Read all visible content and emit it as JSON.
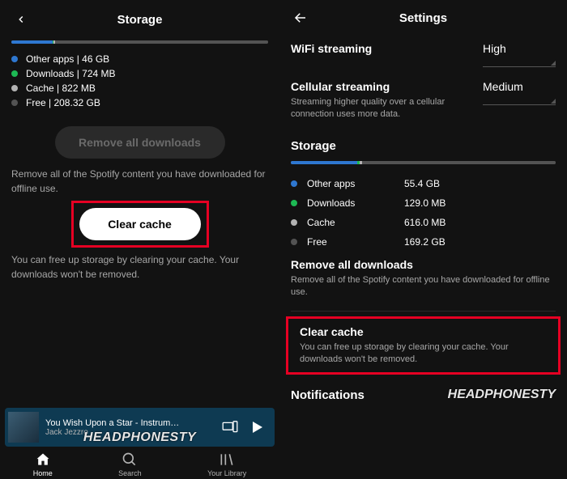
{
  "left": {
    "title": "Storage",
    "bar": {
      "blue": 16,
      "green": 0.5,
      "gray1": 0.5,
      "gray2": 83
    },
    "legend": [
      {
        "colorClass": "dot-blue",
        "label": "Other apps | 46 GB"
      },
      {
        "colorClass": "dot-green",
        "label": "Downloads | 724 MB"
      },
      {
        "colorClass": "dot-gray1",
        "label": "Cache | 822 MB"
      },
      {
        "colorClass": "dot-gray2",
        "label": "Free | 208.32 GB"
      }
    ],
    "remove_btn": "Remove all downloads",
    "remove_desc": "Remove all of the Spotify content you have downloaded for offline use.",
    "clear_btn": "Clear cache",
    "clear_desc": "You can free up storage by clearing your cache. Your downloads won't be removed.",
    "now_playing": {
      "title": "You Wish Upon a Star - Instrum…",
      "artist": "Jack Jezzro"
    },
    "nav": {
      "home": "Home",
      "search": "Search",
      "library": "Your Library"
    }
  },
  "right": {
    "title": "Settings",
    "wifi": {
      "label": "WiFi streaming",
      "value": "High"
    },
    "cellular": {
      "label": "Cellular streaming",
      "sub": "Streaming higher quality over a cellular connection uses more data.",
      "value": "Medium"
    },
    "storage_title": "Storage",
    "bar": {
      "blue": 25,
      "green": 1,
      "gray1": 1,
      "gray2": 73
    },
    "table": [
      {
        "colorClass": "dot-blue",
        "name": "Other apps",
        "value": "55.4 GB"
      },
      {
        "colorClass": "dot-green",
        "name": "Downloads",
        "value": "129.0 MB"
      },
      {
        "colorClass": "dot-gray1",
        "name": "Cache",
        "value": "616.0 MB"
      },
      {
        "colorClass": "dot-gray2",
        "name": "Free",
        "value": "169.2 GB"
      }
    ],
    "remove": {
      "title": "Remove all downloads",
      "desc": "Remove all of the Spotify content you have downloaded for offline use."
    },
    "clear": {
      "title": "Clear cache",
      "desc": "You can free up storage by clearing your cache. Your downloads won't be removed."
    },
    "notifications": "Notifications"
  },
  "watermark": "HEADPHONESTY"
}
